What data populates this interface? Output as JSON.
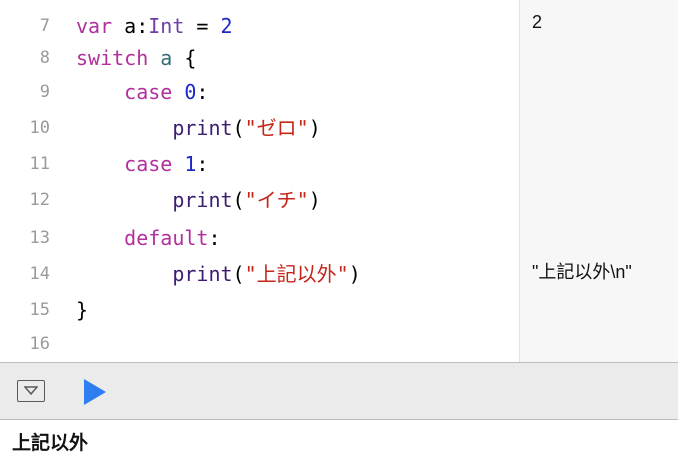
{
  "editor": {
    "lines": [
      {
        "number": "7",
        "tokens": [
          {
            "t": "var",
            "c": "kw"
          },
          {
            "t": " a:",
            "c": "plain"
          },
          {
            "t": "Int",
            "c": "ty"
          },
          {
            "t": " = ",
            "c": "plain"
          },
          {
            "t": "2",
            "c": "num"
          }
        ]
      },
      {
        "number": "8",
        "tokens": [
          {
            "t": "switch",
            "c": "kw"
          },
          {
            "t": " ",
            "c": "plain"
          },
          {
            "t": "a",
            "c": "var"
          },
          {
            "t": " {",
            "c": "plain"
          }
        ]
      },
      {
        "number": "9",
        "tokens": [
          {
            "t": "    case",
            "c": "kw"
          },
          {
            "t": " ",
            "c": "plain"
          },
          {
            "t": "0",
            "c": "num"
          },
          {
            "t": ":",
            "c": "plain"
          }
        ]
      },
      {
        "number": "10",
        "tokens": [
          {
            "t": "        print",
            "c": "fn"
          },
          {
            "t": "(",
            "c": "plain"
          },
          {
            "t": "\"ゼロ\"",
            "c": "str"
          },
          {
            "t": ")",
            "c": "plain"
          }
        ]
      },
      {
        "number": "11",
        "tokens": [
          {
            "t": "    case",
            "c": "kw"
          },
          {
            "t": " ",
            "c": "plain"
          },
          {
            "t": "1",
            "c": "num"
          },
          {
            "t": ":",
            "c": "plain"
          }
        ]
      },
      {
        "number": "12",
        "tokens": [
          {
            "t": "        print",
            "c": "fn"
          },
          {
            "t": "(",
            "c": "plain"
          },
          {
            "t": "\"イチ\"",
            "c": "str"
          },
          {
            "t": ")",
            "c": "plain"
          }
        ]
      },
      {
        "number": "13",
        "tokens": [
          {
            "t": "    default",
            "c": "kw"
          },
          {
            "t": ":",
            "c": "plain"
          }
        ]
      },
      {
        "number": "14",
        "tokens": [
          {
            "t": "        print",
            "c": "fn"
          },
          {
            "t": "(",
            "c": "plain"
          },
          {
            "t": "\"上記以外\"",
            "c": "str"
          },
          {
            "t": ")",
            "c": "plain"
          }
        ]
      },
      {
        "number": "15",
        "tokens": [
          {
            "t": "}",
            "c": "plain"
          }
        ]
      },
      {
        "number": "16",
        "tokens": []
      }
    ]
  },
  "results": {
    "line7": "2",
    "line14": "\"上記以外\\n\""
  },
  "toolbar": {
    "toggle_icon": "debug-area-toggle-icon",
    "run_icon": "play-icon",
    "run_color": "#2f7ef0"
  },
  "console": {
    "output": "上記以外"
  }
}
